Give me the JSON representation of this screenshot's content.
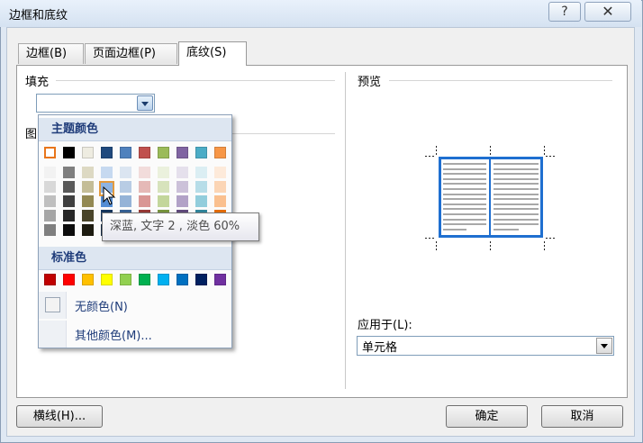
{
  "window": {
    "title": "边框和底纹",
    "help_label": "?",
    "close_label": "✕"
  },
  "tabs": [
    {
      "label": "边框(B)"
    },
    {
      "label": "页面边框(P)"
    },
    {
      "label": "底纹(S)"
    }
  ],
  "fill": {
    "label": "填充",
    "value": ""
  },
  "pattern": {
    "label_partial": "图"
  },
  "palette": {
    "theme_colors_label": "主题颜色",
    "standard_colors_label": "标准色",
    "theme_colors": [
      "#ffffff",
      "#000000",
      "#eeece1",
      "#1f497d",
      "#4f81bd",
      "#c0504d",
      "#9bbb59",
      "#8064a2",
      "#4bacc6",
      "#f79646"
    ],
    "theme_shades": [
      [
        "#f2f2f2",
        "#d8d8d8",
        "#bfbfbf",
        "#a5a5a5",
        "#7f7f7f"
      ],
      [
        "#7f7f7f",
        "#595959",
        "#3f3f3f",
        "#262626",
        "#0c0c0c"
      ],
      [
        "#ddd9c3",
        "#c4bd97",
        "#938953",
        "#494429",
        "#1d1b10"
      ],
      [
        "#c6d9f0",
        "#8db3e2",
        "#548dd4",
        "#17365d",
        "#0f243e"
      ],
      [
        "#dbe5f1",
        "#b8cce4",
        "#95b3d7",
        "#366092",
        "#244061"
      ],
      [
        "#f2dcdb",
        "#e5b9b7",
        "#d99694",
        "#953734",
        "#632423"
      ],
      [
        "#ebf1dd",
        "#d7e3bc",
        "#c3d69b",
        "#76923c",
        "#4f6128"
      ],
      [
        "#e5e0ec",
        "#ccc1d9",
        "#b2a2c7",
        "#5f497a",
        "#3f3151"
      ],
      [
        "#dbeef3",
        "#b7dde8",
        "#92cddc",
        "#31859b",
        "#205867"
      ],
      [
        "#fdeada",
        "#fbd5b5",
        "#fac08f",
        "#e36c09",
        "#974806"
      ]
    ],
    "standard_colors": [
      "#c00000",
      "#ff0000",
      "#ffc000",
      "#ffff00",
      "#92d050",
      "#00b050",
      "#00b0f0",
      "#0070c0",
      "#002060",
      "#7030a0"
    ],
    "no_color_label": "无颜色(N)",
    "more_colors_label": "其他颜色(M)..."
  },
  "tooltip": {
    "text": "深蓝, 文字 2 , 淡色 60%"
  },
  "preview": {
    "label": "预览",
    "border_color": "#1f6fd0"
  },
  "apply_to": {
    "label": "应用于(L):",
    "value": "单元格"
  },
  "buttons": {
    "horizontal_line": "横线(H)...",
    "ok": "确定",
    "cancel": "取消"
  }
}
